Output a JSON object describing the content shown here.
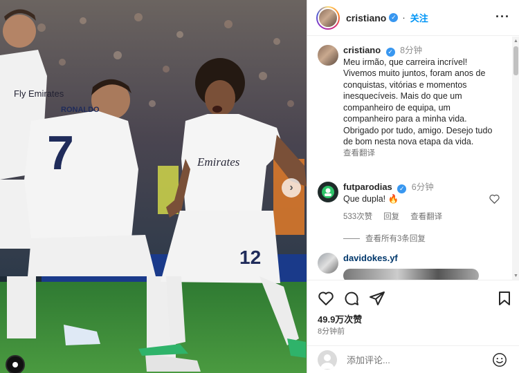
{
  "post": {
    "author": "cristiano",
    "follow_label": "关注",
    "more_label": "···",
    "caption": {
      "author": "cristiano",
      "time": "8分钟",
      "text": "Meu irmão, que carreira incrível! Vivemos muito juntos, foram anos de conquistas, vitórias e momentos inesquecíveis. Mais do que um companheiro de equipa, um companheiro para a minha vida. Obrigado por tudo, amigo. Desejo tudo de bom nesta nova etapa da vida.",
      "translate_label": "查看翻译"
    },
    "comments": [
      {
        "author": "futparodias",
        "time": "6分钟",
        "text": "Que dupla! 🔥",
        "likes": "533次赞",
        "reply_label": "回复",
        "translate_label": "查看翻译",
        "view_replies": "查看所有3条回复"
      },
      {
        "author": "davidokes.yf"
      }
    ],
    "likes_count": "49.9万次赞",
    "posted_time": "8分钟前",
    "add_comment_placeholder": "添加评论...",
    "photo": {
      "jersey_left": "Fly Emirates",
      "jersey_number_left": "7",
      "jersey_name_left": "RONALDO",
      "jersey_front_center": "Emirates",
      "jersey_number_right": "12"
    }
  },
  "colors": {
    "accent": "#0095f6",
    "verified": "#3897f0",
    "pitch": "#3f8a3a"
  }
}
